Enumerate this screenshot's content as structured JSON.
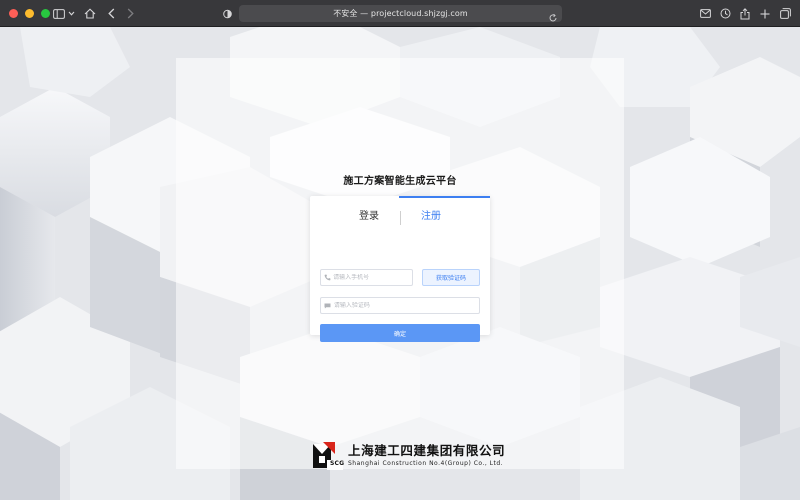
{
  "browser": {
    "url_prefix": "不安全 —",
    "url": "projectcloud.shjzgj.com",
    "traffic_lights": [
      "#fe5f57",
      "#febc2e",
      "#28c840"
    ],
    "toolbar_icons": [
      "sidebar-icon",
      "chevron-down-icon",
      "home-icon",
      "back-icon",
      "forward-icon",
      "privacy-shield-icon",
      "reload-icon",
      "mail-icon",
      "history-icon",
      "share-icon",
      "new-tab-icon",
      "tabs-overview-icon"
    ]
  },
  "page": {
    "title": "施工方案智能生成云平台",
    "tabs": {
      "login": "登录",
      "register": "注册"
    },
    "form": {
      "phone_placeholder": "请输入手机号",
      "get_code_label": "获取验证码",
      "code_placeholder": "请输入验证码",
      "submit_label": "确定"
    },
    "accent_color": "#3d7ff1",
    "footer": {
      "company_cn": "上海建工四建集团有限公司",
      "company_en": "Shanghai Construction No.4(Group) Co., Ltd.",
      "logo_mark": "SCG"
    }
  }
}
